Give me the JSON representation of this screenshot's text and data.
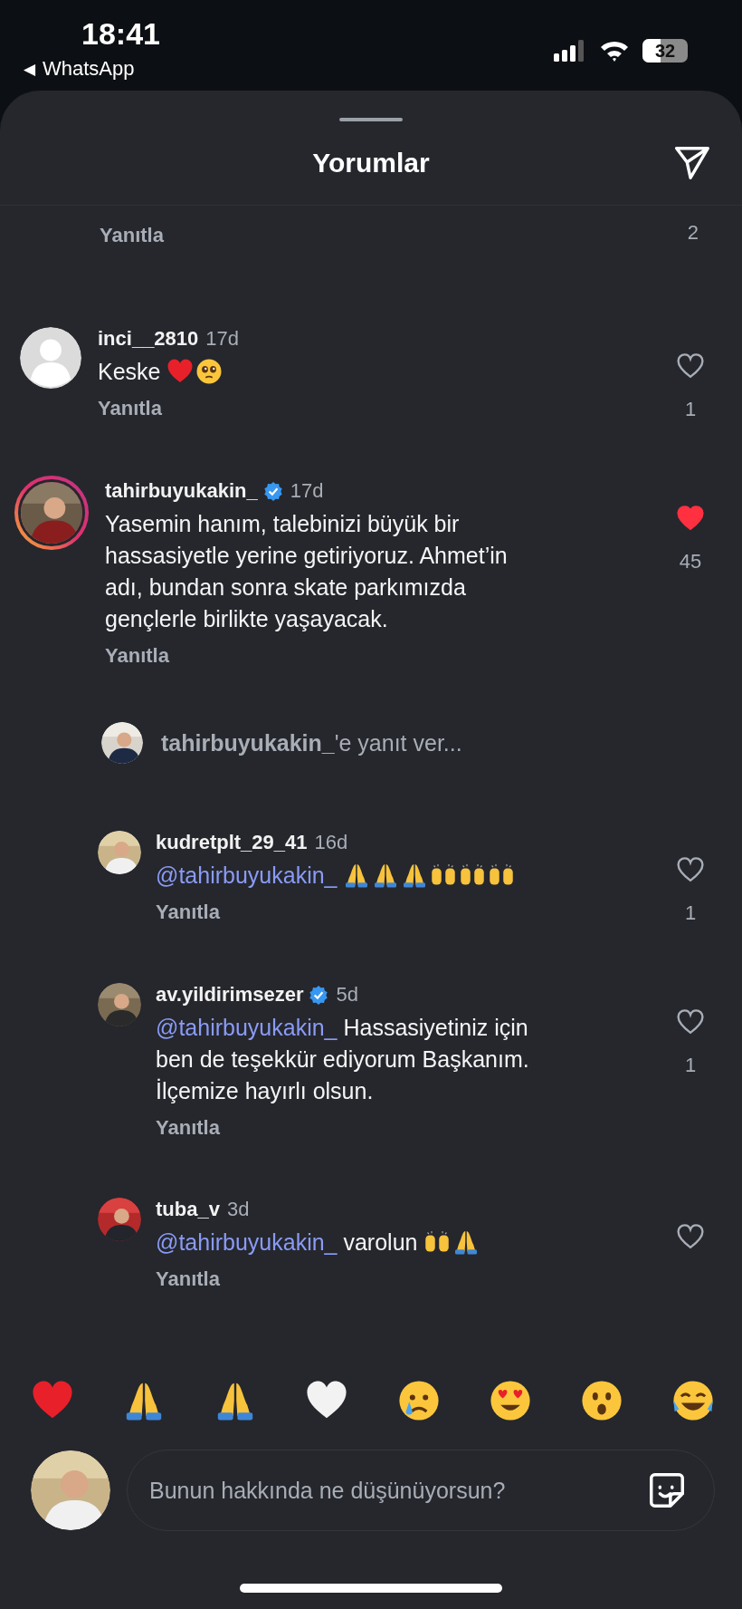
{
  "status_bar": {
    "time": "18:41",
    "back_glyph": "◀",
    "back_label": "WhatsApp",
    "battery": "32"
  },
  "sheet": {
    "title": "Yorumlar"
  },
  "previous": {
    "reply_label": "Yanıtla",
    "like_count": "2"
  },
  "comments": [
    {
      "avatar": {
        "kind": "default"
      },
      "story_ring": false,
      "username": "inci__2810",
      "verified": false,
      "time": "17d",
      "body": [
        {
          "kind": "text",
          "text": "Keske"
        },
        {
          "kind": "heart"
        },
        {
          "kind": "pleading"
        }
      ],
      "reply_label": "Yanıtla",
      "liked": false,
      "like_count": "1"
    },
    {
      "avatar": {
        "kind": "picture"
      },
      "story_ring": true,
      "username": "tahirbuyukakin_",
      "verified": true,
      "time": "17d",
      "body": [
        {
          "kind": "text",
          "text": "Yasemin hanım, talebinizi büyük bir hassasiyetle yerine getiriyoruz. Ahmet’in adı, bundan sonra skate parkımızda gençlerle birlikte yaşayacak."
        }
      ],
      "reply_label": "Yanıtla",
      "liked": true,
      "like_count": "45",
      "reply_prompt": {
        "name": "tahirbuyukakin_",
        "suffix": "'e yanıt ver..."
      },
      "children": [
        {
          "avatar": {
            "kind": "picture"
          },
          "story_ring": false,
          "username": "kudretplt_29_41",
          "verified": false,
          "time": "16d",
          "body": [
            {
              "kind": "mention",
              "text": "@tahirbuyukakin_"
            },
            {
              "kind": "pray"
            },
            {
              "kind": "pray"
            },
            {
              "kind": "pray"
            },
            {
              "kind": "raised"
            },
            {
              "kind": "raised"
            },
            {
              "kind": "raised"
            }
          ],
          "reply_label": "Yanıtla",
          "liked": false,
          "like_count": "1"
        },
        {
          "avatar": {
            "kind": "picture"
          },
          "story_ring": false,
          "username": "av.yildirimsezer",
          "verified": true,
          "time": "5d",
          "body": [
            {
              "kind": "mention",
              "text": "@tahirbuyukakin_"
            },
            {
              "kind": "text",
              "text": "Hassasiyetiniz için ben de teşekkür ediyorum Başkanım. İlçemize hayırlı olsun."
            }
          ],
          "reply_label": "Yanıtla",
          "liked": false,
          "like_count": "1"
        },
        {
          "avatar": {
            "kind": "picture"
          },
          "story_ring": false,
          "username": "tuba_v",
          "verified": false,
          "time": "3d",
          "body": [
            {
              "kind": "mention",
              "text": "@tahirbuyukakin_"
            },
            {
              "kind": "text",
              "text": "varolun"
            },
            {
              "kind": "raised"
            },
            {
              "kind": "pray"
            }
          ],
          "reply_label": "Yanıtla",
          "liked": false
        }
      ]
    }
  ],
  "reactions": [
    {
      "kind": "heart"
    },
    {
      "kind": "pray"
    },
    {
      "kind": "pray"
    },
    {
      "kind": "white_heart"
    },
    {
      "kind": "cry"
    },
    {
      "kind": "heart_eyes"
    },
    {
      "kind": "surprised"
    },
    {
      "kind": "laugh"
    }
  ],
  "composer": {
    "placeholder": "Bunun hakkında ne düşünüyorsun?"
  }
}
